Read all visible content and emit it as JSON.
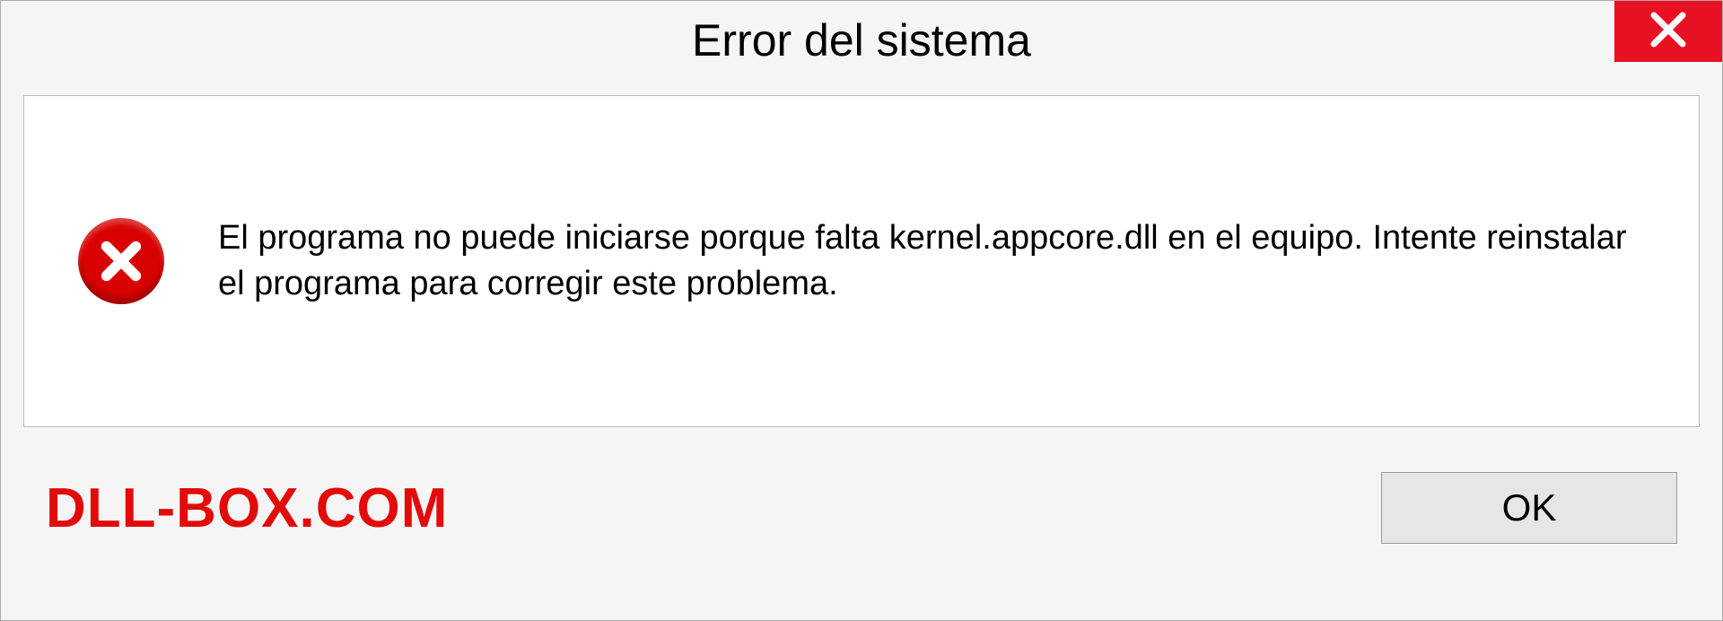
{
  "dialog": {
    "title": "Error del sistema",
    "message": "El programa no puede iniciarse porque falta kernel.appcore.dll en el equipo. Intente reinstalar el programa para corregir este problema.",
    "ok_label": "OK"
  },
  "watermark": "DLL-BOX.COM",
  "colors": {
    "close_bg": "#e81123",
    "error_icon_bg": "#d80000",
    "watermark_color": "#e30a0a"
  }
}
